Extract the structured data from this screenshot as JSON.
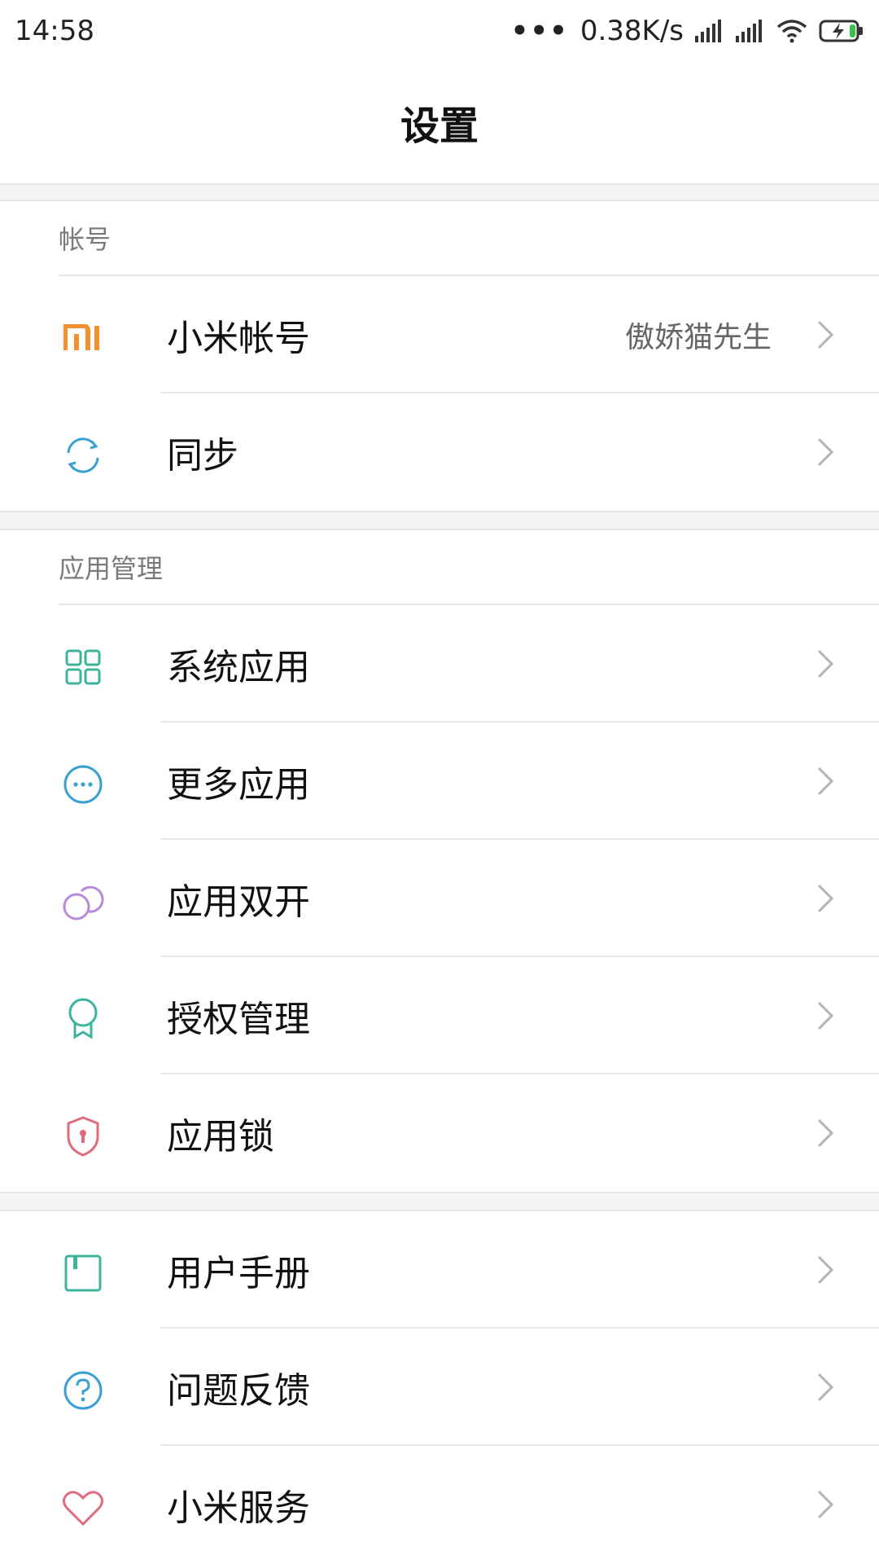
{
  "status_bar": {
    "time": "14:58",
    "dots": "•••",
    "net_speed": "0.38K/s"
  },
  "header": {
    "title": "设置"
  },
  "sections": {
    "account": {
      "title": "帐号",
      "items": [
        {
          "label": "小米帐号",
          "value": "傲娇猫先生",
          "icon": "mi-logo-icon",
          "icon_color": "#f5902e"
        },
        {
          "label": "同步",
          "icon": "sync-icon",
          "icon_color": "#3a9fd1"
        }
      ]
    },
    "apps": {
      "title": "应用管理",
      "items": [
        {
          "label": "系统应用",
          "icon": "grid-icon",
          "icon_color": "#3cb39c"
        },
        {
          "label": "更多应用",
          "icon": "more-icon",
          "icon_color": "#3a9fd1"
        },
        {
          "label": "应用双开",
          "icon": "dual-app-icon",
          "icon_color": "#b88ad9"
        },
        {
          "label": "授权管理",
          "icon": "badge-icon",
          "icon_color": "#3cb39c"
        },
        {
          "label": "应用锁",
          "icon": "shield-lock-icon",
          "icon_color": "#e06b7d"
        }
      ]
    },
    "help": {
      "items": [
        {
          "label": "用户手册",
          "icon": "book-icon",
          "icon_color": "#3cb39c"
        },
        {
          "label": "问题反馈",
          "icon": "question-icon",
          "icon_color": "#3a9fd1"
        },
        {
          "label": "小米服务",
          "icon": "heart-icon",
          "icon_color": "#e06b7d"
        }
      ]
    }
  }
}
